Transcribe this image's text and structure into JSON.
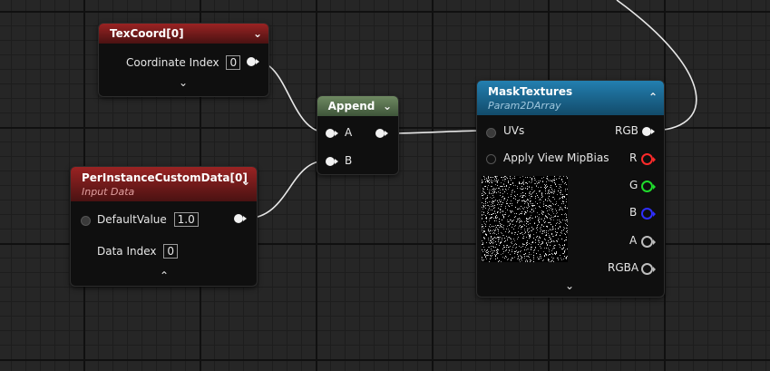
{
  "nodes": {
    "texcoord": {
      "title": "TexCoord[0]",
      "rows": {
        "coordinate_index_label": "Coordinate Index",
        "coordinate_index_value": "0"
      },
      "expand_glyph": "⌄",
      "collapse_glyph": "⌄"
    },
    "append": {
      "title": "Append",
      "collapse_glyph": "⌄",
      "inputs": {
        "a": "A",
        "b": "B"
      }
    },
    "per_instance": {
      "title": "PerInstanceCustomData[0]",
      "subtitle": "Input Data",
      "collapse_glyph": "⌄",
      "rows": {
        "default_value_label": "DefaultValue",
        "default_value": "1.0",
        "data_index_label": "Data Index",
        "data_index_value": "0"
      },
      "footer_glyph": "⌃"
    },
    "mask_textures": {
      "title": "MaskTextures",
      "subtitle": "Param2DArray",
      "collapse_glyph": "⌃",
      "inputs": {
        "uvs": "UVs",
        "apply_view_mipbias": "Apply View MipBias"
      },
      "outputs": {
        "rgb": "RGB",
        "r": "R",
        "g": "G",
        "b": "B",
        "a": "A",
        "rgba": "RGBA"
      },
      "footer_glyph": "⌄"
    }
  },
  "colors": {
    "header_red": "#9a2323",
    "header_green": "#6f8a62",
    "header_blue": "#237fb0",
    "pin_r": "#ff2a2a",
    "pin_g": "#1fdc2c",
    "pin_b": "#2f2fff",
    "wire": "#e8e8e8"
  }
}
